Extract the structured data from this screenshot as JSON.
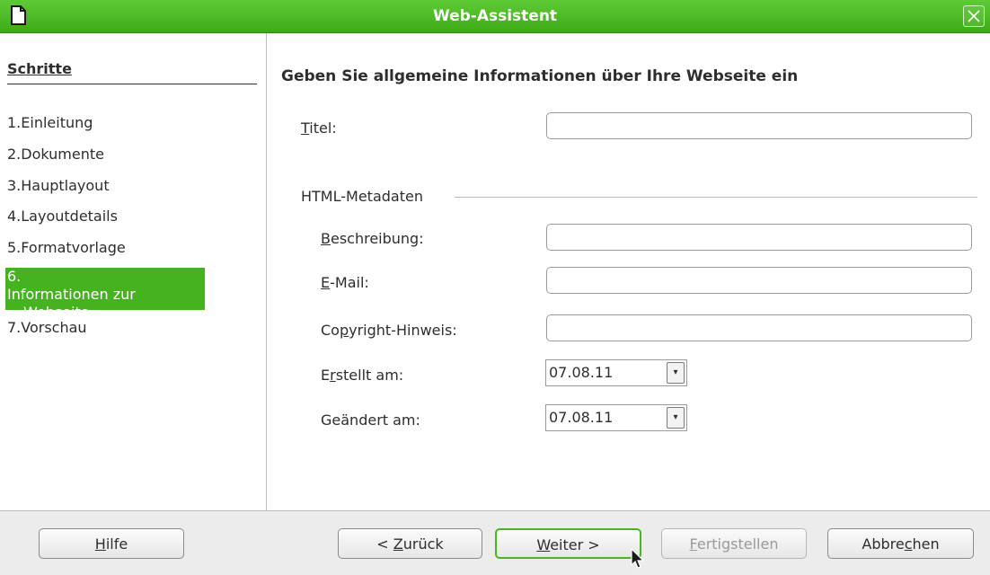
{
  "window": {
    "title": "Web-Assistent"
  },
  "steps": {
    "heading": "Schritte",
    "items": [
      {
        "num": "1.",
        "label": "Einleitung"
      },
      {
        "num": "2.",
        "label": "Dokumente"
      },
      {
        "num": "3.",
        "label": "Hauptlayout"
      },
      {
        "num": "4.",
        "label": "Layoutdetails"
      },
      {
        "num": "5.",
        "label": "Formatvorlage"
      },
      {
        "num": "6.",
        "label": "Informationen zur",
        "label2": "Webseite"
      },
      {
        "num": "7.",
        "label": "Vorschau"
      }
    ],
    "active_index": 6
  },
  "panel": {
    "heading": "Geben Sie allgemeine Informationen über Ihre Webseite ein",
    "title_label": {
      "accel": "T",
      "rest": "itel:"
    },
    "title_value": "",
    "meta_group": "HTML-Metadaten",
    "description_label": {
      "accel": "B",
      "rest": "eschreibung:"
    },
    "email_label": {
      "accel": "E",
      "rest": "-Mail:"
    },
    "copyright_label": {
      "pre": "Co",
      "accel": "p",
      "rest": "yright-Hinweis:"
    },
    "created_label": {
      "pre": "E",
      "accel": "r",
      "rest": "stellt am:"
    },
    "created_value": "07.08.11",
    "modified_label": "Geändert am:",
    "modified_value": "07.08.11"
  },
  "buttons": {
    "help": {
      "accel": "H",
      "rest": "ilfe"
    },
    "back": {
      "pre": "< ",
      "accel": "Z",
      "rest": "urück"
    },
    "next": {
      "accel": "W",
      "rest": "eiter >"
    },
    "finish": {
      "accel": "F",
      "rest": "ertigstellen"
    },
    "cancel": {
      "pre": "Abbre",
      "accel": "c",
      "rest": "hen"
    }
  },
  "colors": {
    "accent": "#45b21f",
    "titlebar": "#4dbb22"
  }
}
